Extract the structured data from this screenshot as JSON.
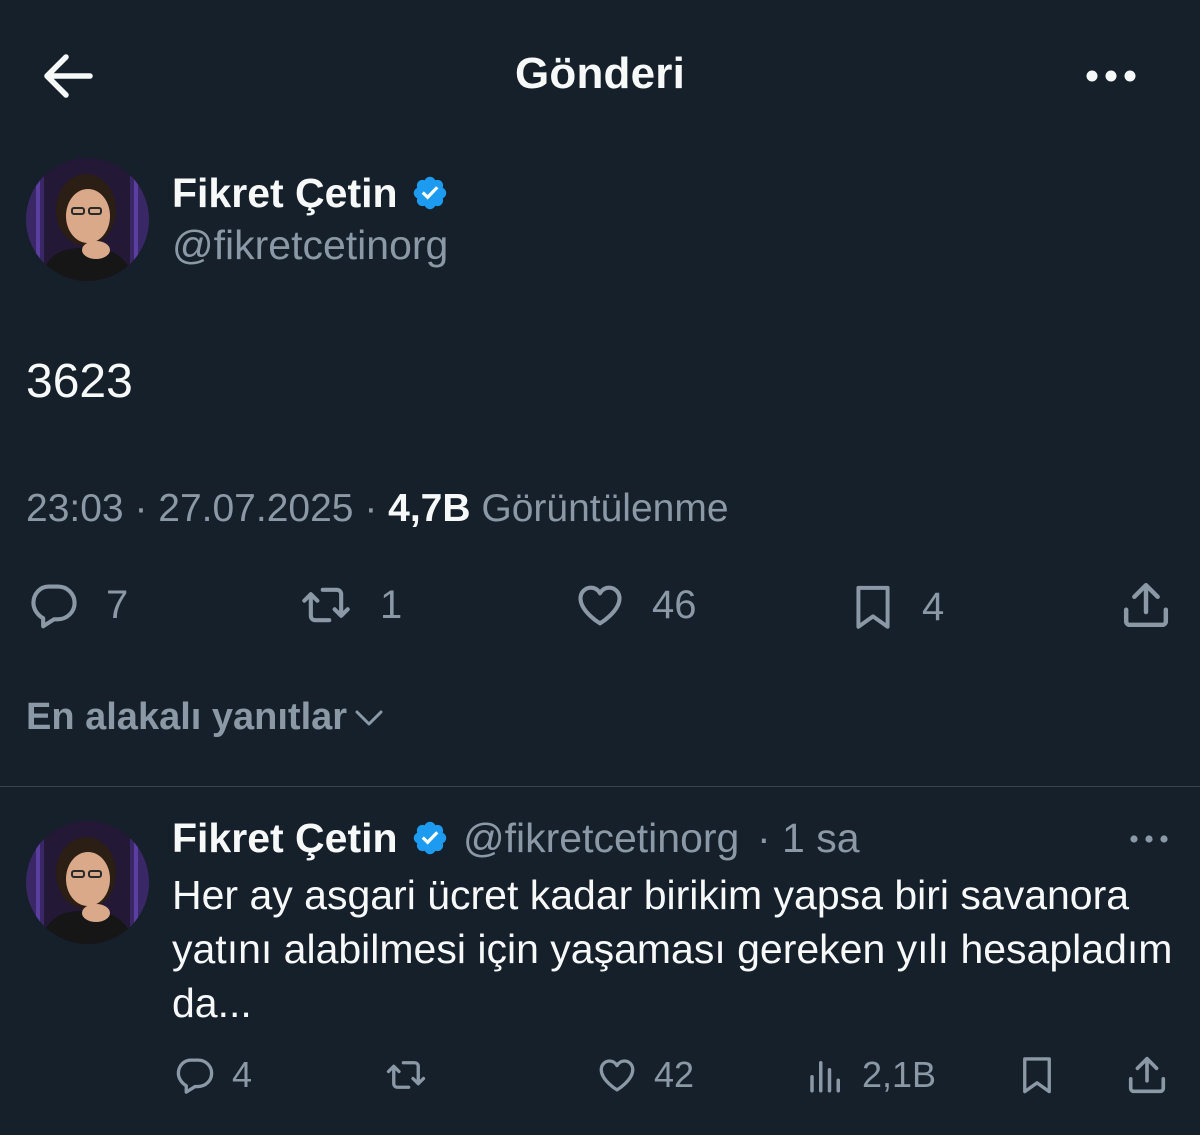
{
  "header": {
    "title": "Gönderi"
  },
  "post": {
    "author_name": "Fikret Çetin",
    "handle": "@fikretcetinorg",
    "text": "3623",
    "time": "23:03",
    "date": "27.07.2025",
    "views_count": "4,7B",
    "views_label": "Görüntülenme",
    "actions": {
      "replies": "7",
      "reposts": "1",
      "likes": "46",
      "bookmarks": "4"
    }
  },
  "replies_sort": {
    "label": "En alakalı yanıtlar"
  },
  "reply": {
    "author_name": "Fikret Çetin",
    "handle": "@fikretcetinorg",
    "time": "· 1 sa",
    "text": "Her ay asgari ücret kadar birikim yapsa biri savanora yatını alabilmesi için yaşaması gereken yılı hesapladım da...",
    "actions": {
      "replies": "4",
      "likes": "42",
      "views": "2,1B"
    }
  },
  "colors": {
    "background": "#15202b",
    "text_primary": "#f7f9f9",
    "text_secondary": "#8b98a5",
    "verified": "#1d9bf0",
    "divider": "#38444d"
  }
}
